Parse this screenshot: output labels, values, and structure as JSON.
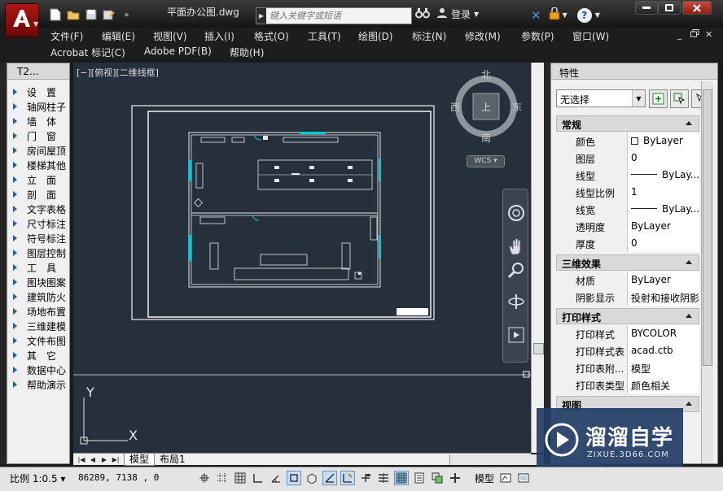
{
  "app": {
    "doc_title": "平面办公图.dwg",
    "search_placeholder": "键入关键字或短语",
    "login": "登录",
    "help_glyph": "?"
  },
  "menu": {
    "row1": [
      "文件(F)",
      "编辑(E)",
      "视图(V)",
      "插入(I)",
      "格式(O)",
      "工具(T)",
      "绘图(D)",
      "标注(N)",
      "修改(M)",
      "参数(P)",
      "窗口(W)"
    ],
    "row2": [
      "Acrobat 标记(C)",
      "Adobe PDF(B)",
      "帮助(H)"
    ]
  },
  "left_palette": {
    "title": "T2...",
    "items": [
      "设　置",
      "轴网柱子",
      "墙　体",
      "门　窗",
      "房间屋顶",
      "楼梯其他",
      "立　面",
      "剖　面",
      "文字表格",
      "尺寸标注",
      "符号标注",
      "图层控制",
      "工　具",
      "图块图案",
      "建筑防火",
      "场地布置",
      "三维建模",
      "文件布图",
      "其　它",
      "数据中心",
      "帮助演示"
    ]
  },
  "viewport": {
    "label": "[−][俯视][二维线框]",
    "compass": {
      "north": "北",
      "south": "南",
      "east": "东",
      "west": "西",
      "top": "上"
    },
    "wcs": "WCS ▾",
    "ucs_x": "X",
    "ucs_y": "Y"
  },
  "tabs": [
    "模型",
    "布局1"
  ],
  "properties": {
    "title": "特性",
    "selection": "无选择",
    "sections": [
      {
        "title": "常规",
        "rows": [
          {
            "key": "颜色",
            "value": "ByLayer",
            "swatch": true
          },
          {
            "key": "图层",
            "value": "0"
          },
          {
            "key": "线型",
            "value": "ByLay...",
            "line": true
          },
          {
            "key": "线型比例",
            "value": "1"
          },
          {
            "key": "线宽",
            "value": "ByLay...",
            "line": true
          },
          {
            "key": "透明度",
            "value": "ByLayer"
          },
          {
            "key": "厚度",
            "value": "0"
          }
        ]
      },
      {
        "title": "三维效果",
        "rows": [
          {
            "key": "材质",
            "value": "ByLayer"
          },
          {
            "key": "阴影显示",
            "value": "投射和接收阴影"
          }
        ]
      },
      {
        "title": "打印样式",
        "rows": [
          {
            "key": "打印样式",
            "value": "BYCOLOR"
          },
          {
            "key": "打印样式表",
            "value": "acad.ctb"
          },
          {
            "key": "打印表附...",
            "value": "模型"
          },
          {
            "key": "打印表类型",
            "value": "颜色相关"
          }
        ]
      },
      {
        "title": "视图",
        "rows": []
      }
    ]
  },
  "status": {
    "scale": "比例 1:0.5 ▾",
    "coords": "86289, 7138 , 0",
    "model": "模型"
  },
  "watermark": {
    "name": "溜溜自学",
    "url": "ZIXUE.3D66.COM"
  },
  "colors": {
    "canvas": "#25303c",
    "accent": "#00c8d8",
    "chrome_dark": "#1d1d1d"
  }
}
